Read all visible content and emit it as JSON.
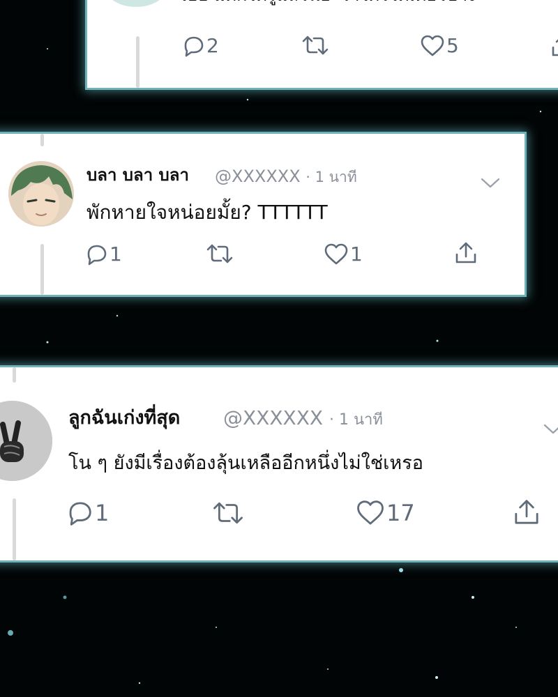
{
  "tweets": [
    {
      "text": "เฮ้อ แต่กได้รู้แล้วนี่อะว่าใครได้เดี๋ยวบ้าง",
      "reply_count": "2",
      "like_count": "5"
    },
    {
      "name": "บลา บลา บลา",
      "handle": "@XXXXXX",
      "time": "· 1 นาที",
      "text": "พักหายใจหน่อยมั้ย? TTTTTT",
      "reply_count": "1",
      "like_count": "1"
    },
    {
      "name": "ลูกฉันเก่งที่สุด",
      "handle": "@XXXXXX",
      "time": "· 1 นาที",
      "text": "โน ๆ ยังมีเรื่องต้องลุ้นเหลืออีกหนึ่งไม่ใช่เหรอ",
      "reply_count": "1",
      "like_count": "17"
    }
  ],
  "icons": {
    "reply": "reply-icon",
    "retweet": "retweet-icon",
    "like": "heart-icon",
    "share": "share-icon",
    "menu": "chevron-down-icon"
  },
  "colors": {
    "glow": "#6fb3b8",
    "icon": "#5f6b78",
    "handle": "#8a9099",
    "background": "#020506"
  }
}
